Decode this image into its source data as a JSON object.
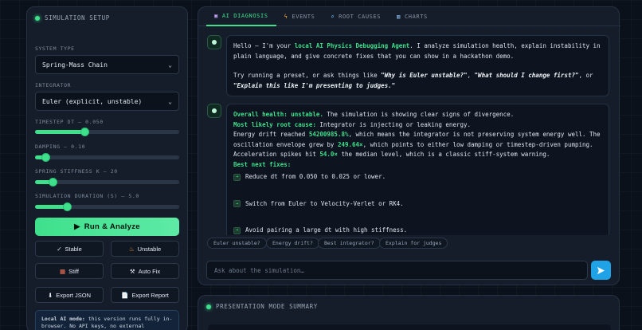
{
  "setup": {
    "title": "SIMULATION SETUP",
    "system_type_label": "SYSTEM TYPE",
    "system_type_value": "Spring-Mass Chain",
    "integrator_label": "INTEGRATOR",
    "integrator_value": "Euler (explicit, unstable)",
    "sliders": [
      {
        "label": "TIMESTEP DT — 0.050",
        "level": 0.34
      },
      {
        "label": "DAMPING — 0.10",
        "level": 0.07
      },
      {
        "label": "SPRING STIFFNESS K — 20",
        "level": 0.12
      },
      {
        "label": "SIMULATION DURATION (S) — 5.0",
        "level": 0.22
      }
    ],
    "run_label": "Run & Analyze",
    "buttons": {
      "stable": "Stable",
      "unstable": "Unstable",
      "stiff": "Stiff",
      "autofix": "Auto Fix",
      "export_json": "Export JSON",
      "export_report": "Export Report"
    },
    "note_bold": "Local AI mode:",
    "note_text": "this version runs fully in-browser. No API keys, no external"
  },
  "tabs": [
    {
      "label": "AI DIAGNOSIS",
      "icon": "robot-icon"
    },
    {
      "label": "EVENTS",
      "icon": "bolt-icon"
    },
    {
      "label": "ROOT CAUSES",
      "icon": "magnifier-icon"
    },
    {
      "label": "CHARTS",
      "icon": "chart-icon"
    }
  ],
  "intro": {
    "p1_a": "Hello — I'm your ",
    "p1_hl": "local AI Physics Debugging Agent",
    "p1_b": ". I analyze simulation health, explain instability in plain language, and give concrete fixes that you can show in a hackathon demo.",
    "p2_a": "Try running a preset, or ask things like ",
    "p2_q1": "\"Why is Euler unstable?\"",
    "p2_b": ", ",
    "p2_q2": "\"What should I change first?\"",
    "p2_c": ", or ",
    "p2_q3": "\"Explain this like I'm presenting to judges.\""
  },
  "diagnosis": {
    "health_label": "Overall health: unstable.",
    "health_text": " The simulation is showing clear signs of divergence.",
    "cause_label": "Most likely root cause:",
    "cause_text": " Integrator is injecting or leaking energy.",
    "drift_a": "Energy drift reached ",
    "drift_val": "54200985.8%",
    "drift_b": ", which means the integrator is not preserving system energy well. The oscillation envelope grew by ",
    "env_val": "249.64×",
    "drift_c": ", which points to either low damping or timestep-driven pumping. Acceleration spikes hit ",
    "acc_val": "54.0×",
    "drift_d": " the median level, which is a classic stiff-system warning.",
    "fixes_label": "Best next fixes:",
    "fixes": [
      "Reduce dt from 0.050 to 0.025 or lower.",
      "Switch from Euler to Velocity-Verlet or RK4.",
      "Avoid pairing a large dt with high stiffness."
    ]
  },
  "chips": [
    "Euler unstable?",
    "Energy drift?",
    "Best integrator?",
    "Explain for judges"
  ],
  "input_placeholder": "Ask about the simulation…",
  "summary_title": "PRESENTATION MODE SUMMARY"
}
